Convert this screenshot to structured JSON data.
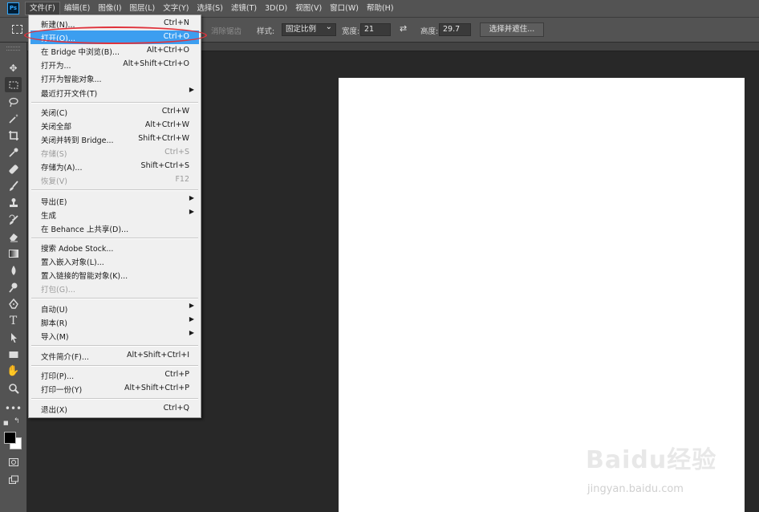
{
  "menubar": {
    "logo": "Ps",
    "items": [
      "文件(F)",
      "编辑(E)",
      "图像(I)",
      "图层(L)",
      "文字(Y)",
      "选择(S)",
      "滤镜(T)",
      "3D(D)",
      "视图(V)",
      "窗口(W)",
      "帮助(H)"
    ]
  },
  "options": {
    "antialias": "消除锯齿",
    "style_label": "样式:",
    "style_value": "固定比例",
    "width_label": "宽度:",
    "width_value": "21",
    "height_label": "高度:",
    "height_value": "29.7",
    "select_mask_button": "选择并遮住..."
  },
  "file_menu": {
    "items": [
      {
        "label": "新建(N)...",
        "shortcut": "Ctrl+N"
      },
      {
        "label": "打开(O)...",
        "shortcut": "Ctrl+O",
        "highlighted": true
      },
      {
        "label": "在 Bridge 中浏览(B)...",
        "shortcut": "Alt+Ctrl+O"
      },
      {
        "label": "打开为...",
        "shortcut": "Alt+Shift+Ctrl+O"
      },
      {
        "label": "打开为智能对象..."
      },
      {
        "label": "最近打开文件(T)",
        "submenu": true
      },
      {
        "label": "关闭(C)",
        "shortcut": "Ctrl+W"
      },
      {
        "label": "关闭全部",
        "shortcut": "Alt+Ctrl+W"
      },
      {
        "label": "关闭并转到 Bridge...",
        "shortcut": "Shift+Ctrl+W"
      },
      {
        "label": "存储(S)",
        "shortcut": "Ctrl+S",
        "disabled": true
      },
      {
        "label": "存储为(A)...",
        "shortcut": "Shift+Ctrl+S"
      },
      {
        "label": "恢复(V)",
        "shortcut": "F12",
        "disabled": true
      },
      {
        "label": "导出(E)",
        "submenu": true
      },
      {
        "label": "生成",
        "submenu": true
      },
      {
        "label": "在 Behance 上共享(D)..."
      },
      {
        "label": "搜索 Adobe Stock..."
      },
      {
        "label": "置入嵌入对象(L)..."
      },
      {
        "label": "置入链接的智能对象(K)..."
      },
      {
        "label": "打包(G)...",
        "disabled": true
      },
      {
        "label": "自动(U)",
        "submenu": true
      },
      {
        "label": "脚本(R)",
        "submenu": true
      },
      {
        "label": "导入(M)",
        "submenu": true
      },
      {
        "label": "文件简介(F)...",
        "shortcut": "Alt+Shift+Ctrl+I"
      },
      {
        "label": "打印(P)...",
        "shortcut": "Ctrl+P"
      },
      {
        "label": "打印一份(Y)",
        "shortcut": "Alt+Shift+Ctrl+P"
      },
      {
        "label": "退出(X)",
        "shortcut": "Ctrl+Q"
      }
    ]
  },
  "watermark": {
    "brand": "Baidu经验",
    "url": "jingyan.baidu.com"
  },
  "colors": {
    "highlight": "#3c9ef0",
    "annotation": "#e0323b",
    "panel": "#535353",
    "workspace": "#282828"
  }
}
